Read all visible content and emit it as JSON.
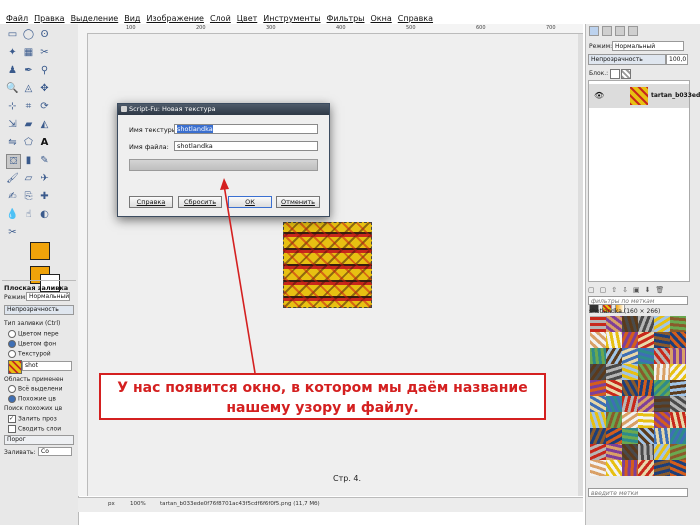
{
  "menu": [
    "Файл",
    "Правка",
    "Выделение",
    "Вид",
    "Изображение",
    "Слой",
    "Цвет",
    "Инструменты",
    "Фильтры",
    "Окна",
    "Справка"
  ],
  "ruler": {
    "ticks": [
      "0",
      "100",
      "200",
      "300",
      "400",
      "500",
      "600",
      "700"
    ]
  },
  "toolbox": {
    "options_title": "Плоская заливка",
    "mode_label": "Режим:",
    "mode_value": "Нормальный",
    "opacity_label": "Непрозрачность",
    "fill_type_label": "Тип заливки  (Ctrl)",
    "fill_options": [
      "Цветом пере",
      "Цветом фон",
      "Текстурой"
    ],
    "pattern_name": "shot",
    "area_label": "Область применен",
    "area_options": [
      "Всё выделени",
      "Похожие цв"
    ],
    "search_label": "Поиск похожих цв",
    "check_options": [
      "Залить проз",
      "Сводить слои"
    ],
    "threshold_label": "Порог",
    "fill_by_label": "Заливать:",
    "fill_by_value": "Со"
  },
  "dialog": {
    "title": "Script-Fu: Новая текстура",
    "texture_label": "Имя текстуры:",
    "texture_value": "shotlandka",
    "file_label": "Имя файла:",
    "file_value": "shotlandka",
    "buttons": {
      "help": "Справка",
      "reset": "Сбросить",
      "ok": "ОК",
      "cancel": "Отменить"
    }
  },
  "annotation": {
    "line1": "У нас появится окно, в котором  мы даём название",
    "line2": "нашему узору и файлу."
  },
  "page_number": "Стр. 4.",
  "statusbar": {
    "unit": "px",
    "zoom": "100%",
    "file": "tartan_b033ede0f76f8701ac43f5cdf6f6f0f5.png (11,7 Мб)"
  },
  "layers_panel": {
    "mode_label": "Режим:",
    "mode_value": "Нормальный",
    "opacity_label": "Непрозрачность",
    "opacity_value": "100,0",
    "lock_label": "Блок.:",
    "layer_name": "tartan_b033ede"
  },
  "patterns_panel": {
    "filter_placeholder": "фильтры по меткам",
    "selected": "shotlandka (160 × 266)",
    "tag_placeholder": "введите метки"
  },
  "colors": {
    "accent_red": "#d42020",
    "fg_color": "#f0a30a",
    "selection_blue": "#3a6fd0"
  }
}
